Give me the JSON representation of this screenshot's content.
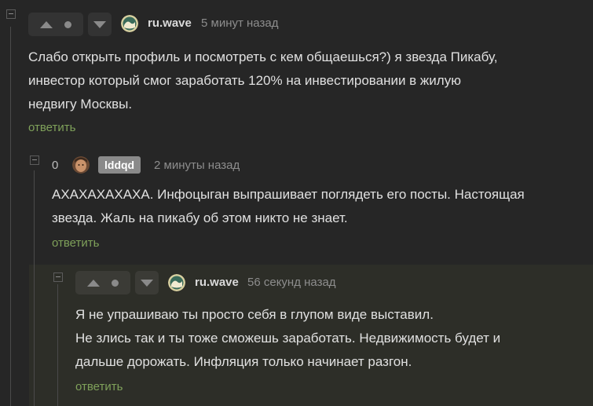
{
  "comments": [
    {
      "username": "ru.wave",
      "time": "5 минут назад",
      "text_lines": [
        "Слабо открыть профиль и посмотреть с кем общаешься?) я звезда Пикабу,",
        "инвестор который смог заработать 120% на инвестировании в жилую",
        "недвигу Москвы."
      ],
      "reply_label": "ответить"
    },
    {
      "rating": "0",
      "username": "lddqd",
      "time": "2 минуты назад",
      "text_lines": [
        "АХАХАХАХАХА. Инфоцыган выпрашивает поглядеть его посты. Настоящая",
        "звезда. Жаль на пикабу об этом никто не знает."
      ],
      "reply_label": "ответить"
    },
    {
      "username": "ru.wave",
      "time": "56 секунд назад",
      "text_lines": [
        "Я не упрашиваю ты просто себя в глупом виде выставил.",
        "Не злись так и ты тоже сможешь заработать. Недвижимость будет и",
        "дальше дорожать. Инфляция только начинает разгон."
      ],
      "reply_label": "ответить"
    }
  ],
  "colors": {
    "background": "#262626",
    "highlight": "#2d2e28",
    "reply_link": "#7fa15a",
    "badge": "#8a8a8a"
  }
}
